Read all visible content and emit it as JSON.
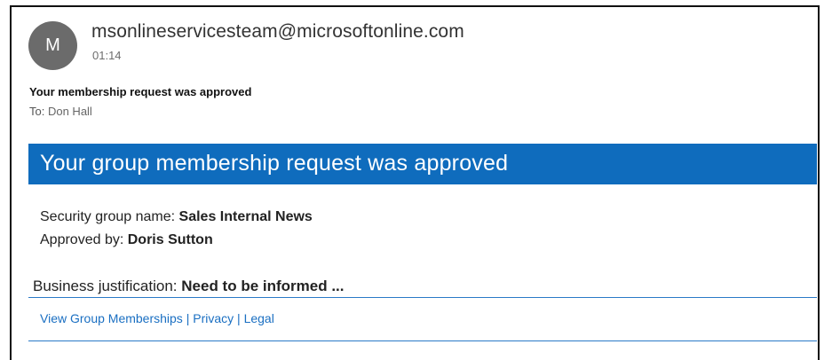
{
  "email": {
    "avatar_initial": "M",
    "sender": "msonlineservicesteam@microsoftonline.com",
    "time": "01:14",
    "subject": "Your membership request was approved",
    "to_label": "To:",
    "to_name": "Don Hall"
  },
  "body": {
    "banner_title": "Your group membership request was approved",
    "group_label": "Security group name:",
    "group_value": "Sales Internal News",
    "approved_label": "Approved by:",
    "approved_value": "Doris Sutton",
    "justification_label": "Business justification:",
    "justification_value": "Need to be informed ..."
  },
  "footer": {
    "links": [
      "View Group Memberships",
      "Privacy",
      "Legal"
    ],
    "separator": "|"
  },
  "colors": {
    "banner": "#0f6cbd",
    "link": "#1a6fc2",
    "avatar": "#6b6b6b"
  }
}
